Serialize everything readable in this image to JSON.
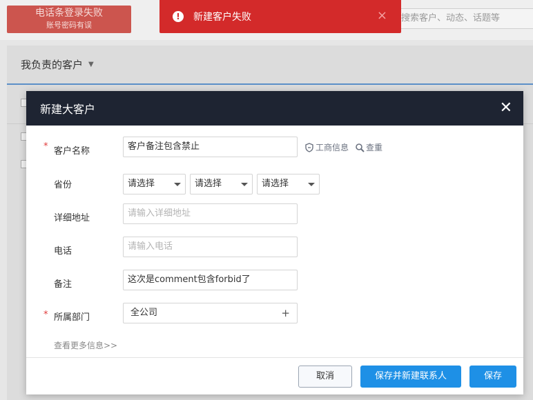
{
  "background": {
    "login_error": {
      "line1": "电话条登录失败",
      "line2": "账号密码有误"
    },
    "search_placeholder": "搜索客户、动态、话题等",
    "panel_title": "我负责的客户"
  },
  "toast": {
    "message": "新建客户失败",
    "icon": "exclamation-circle-icon",
    "close_symbol": "×",
    "color": "#d32a2a"
  },
  "modal": {
    "title": "新建大客户",
    "close_symbol": "✕",
    "header_color": "#1e2432",
    "fields": {
      "customer_name": {
        "label": "客户名称",
        "required": "*",
        "value": "客户备注包含禁止"
      },
      "biz_info_link": "工商信息",
      "recheck_link": "查重",
      "province": {
        "label": "省份",
        "selects": [
          "请选择",
          "请选择",
          "请选择"
        ]
      },
      "address": {
        "label": "详细地址",
        "placeholder": "请输入详细地址"
      },
      "phone": {
        "label": "电话",
        "placeholder": "请输入电话"
      },
      "note": {
        "label": "备注",
        "value": "这次是comment包含forbid了"
      },
      "department": {
        "label": "所属部门",
        "required": "*",
        "value": "全公司",
        "add_symbol": "+"
      }
    },
    "more_info_link": "查看更多信息>>",
    "buttons": {
      "cancel": "取消",
      "save_and_new_contact": "保存并新建联系人",
      "save": "保存"
    },
    "accent_color": "#1e90e6"
  }
}
